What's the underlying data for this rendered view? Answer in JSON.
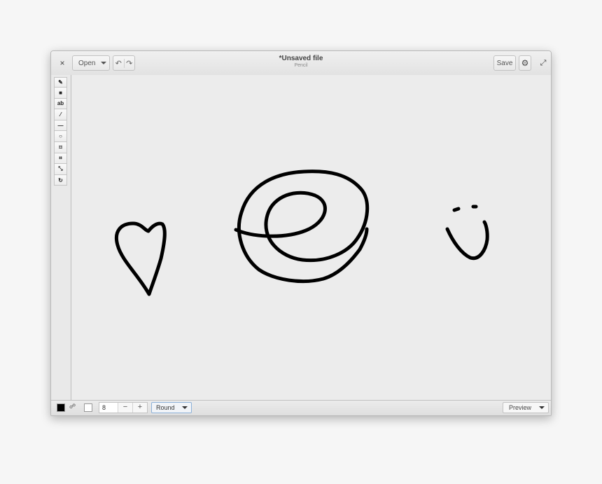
{
  "window": {
    "title": "*Unsaved file",
    "subtitle": "Pencil",
    "close_glyph": "×",
    "open_label": "Open",
    "undo_glyph": "↶",
    "redo_glyph": "↷",
    "save_label": "Save",
    "settings_icon": "gear-icon",
    "settings_glyph": "⚙",
    "maximize_glyph": "⤢"
  },
  "tools": [
    {
      "name": "pencil-icon",
      "glyph": "✎"
    },
    {
      "name": "rectangle-selection-icon",
      "glyph": "■"
    },
    {
      "name": "text-tool-icon",
      "glyph": "ab"
    },
    {
      "name": "color-picker-icon",
      "glyph": "⁄"
    },
    {
      "name": "line-tool-icon",
      "glyph": "—"
    },
    {
      "name": "ellipse-tool-icon",
      "glyph": "○"
    },
    {
      "name": "free-selection-icon",
      "glyph": "⌑"
    },
    {
      "name": "crop-icon",
      "glyph": "⌗"
    },
    {
      "name": "scale-icon",
      "glyph": "⤡"
    },
    {
      "name": "rotate-icon",
      "glyph": "↻"
    }
  ],
  "statusbar": {
    "main_color": "#000000",
    "secondary_color": "#ffffff",
    "layers_glyph": "☍",
    "size_value": "8",
    "minus_glyph": "−",
    "plus_glyph": "+",
    "shape_option": "Round",
    "preview_label": "Preview"
  },
  "accent_color": "#8bb0d8"
}
